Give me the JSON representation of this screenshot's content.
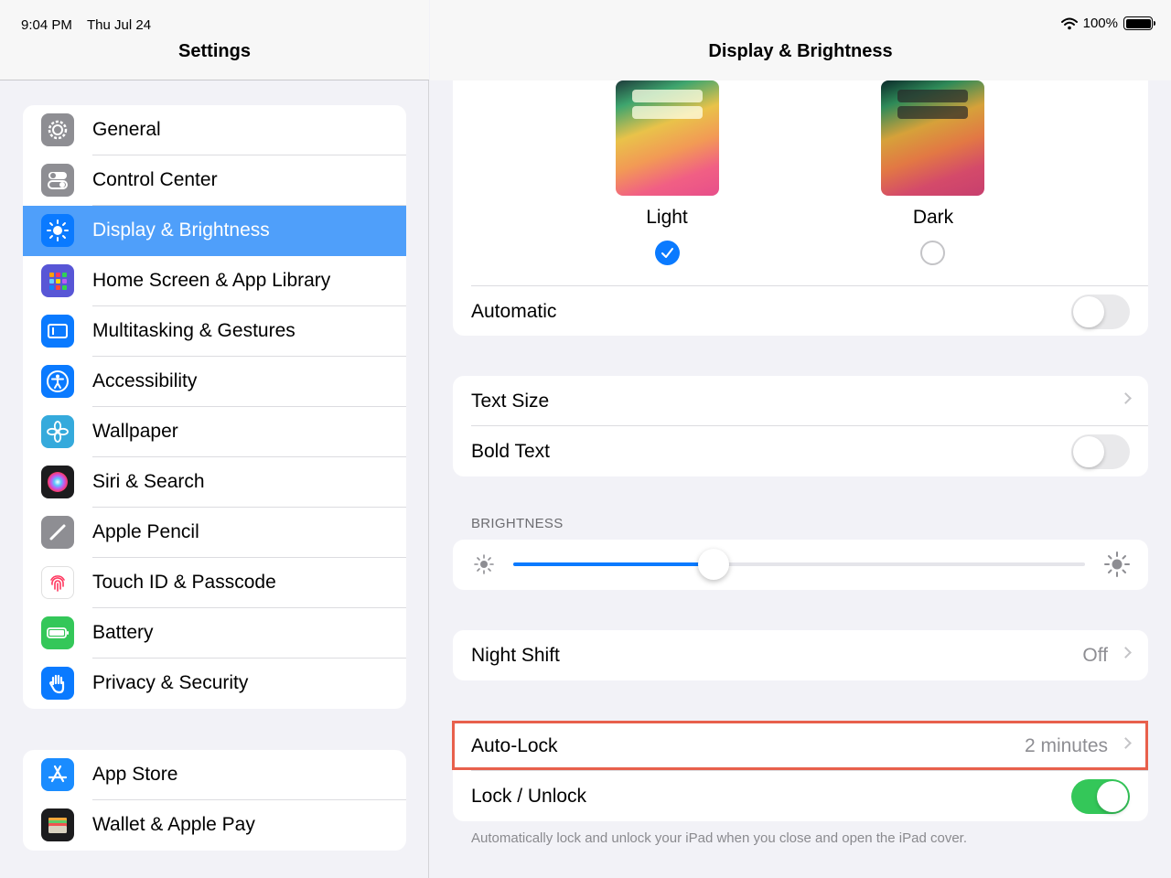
{
  "status": {
    "time": "9:04 PM",
    "date": "Thu Jul 24",
    "battery": "100%"
  },
  "sidebar": {
    "title": "Settings",
    "group1": [
      {
        "label": "General",
        "icon": "gear-icon",
        "color": "#8e8e93"
      },
      {
        "label": "Control Center",
        "icon": "toggles-icon",
        "color": "#8e8e93"
      },
      {
        "label": "Display & Brightness",
        "icon": "sun-icon",
        "color": "#0a7aff",
        "selected": true
      },
      {
        "label": "Home Screen & App Library",
        "icon": "grid-icon",
        "color": "#5856d6"
      },
      {
        "label": "Multitasking & Gestures",
        "icon": "multitasking-icon",
        "color": "#0a7aff"
      },
      {
        "label": "Accessibility",
        "icon": "accessibility-icon",
        "color": "#0a7aff"
      },
      {
        "label": "Wallpaper",
        "icon": "flower-icon",
        "color": "#35aadc"
      },
      {
        "label": "Siri & Search",
        "icon": "siri-icon",
        "color": "#1c1c1e"
      },
      {
        "label": "Apple Pencil",
        "icon": "pencil-icon",
        "color": "#8e8e93"
      },
      {
        "label": "Touch ID & Passcode",
        "icon": "fingerprint-icon",
        "color": "#ffffff"
      },
      {
        "label": "Battery",
        "icon": "battery-icon",
        "color": "#34c759"
      },
      {
        "label": "Privacy & Security",
        "icon": "hand-icon",
        "color": "#0a7aff"
      }
    ],
    "group2": [
      {
        "label": "App Store",
        "icon": "appstore-icon",
        "color": "#1a8cff"
      },
      {
        "label": "Wallet & Apple Pay",
        "icon": "wallet-icon",
        "color": "#1c1c1e"
      }
    ]
  },
  "main": {
    "title": "Display & Brightness",
    "appearance": {
      "light_label": "Light",
      "dark_label": "Dark",
      "selected": "light",
      "automatic_label": "Automatic",
      "automatic_on": false
    },
    "text": {
      "text_size_label": "Text Size",
      "bold_text_label": "Bold Text",
      "bold_text_on": false
    },
    "brightness": {
      "section_label": "BRIGHTNESS",
      "level": 0.35
    },
    "night_shift": {
      "label": "Night Shift",
      "value": "Off"
    },
    "lock": {
      "auto_lock_label": "Auto-Lock",
      "auto_lock_value": "2 minutes",
      "lock_unlock_label": "Lock / Unlock",
      "lock_unlock_on": true,
      "footnote": "Automatically lock and unlock your iPad when you close and open the iPad cover."
    }
  },
  "colors": {
    "accent": "#0a7aff",
    "selected_row": "#4f9ffa",
    "toggle_on": "#34c759",
    "highlight": "#e8604c"
  }
}
